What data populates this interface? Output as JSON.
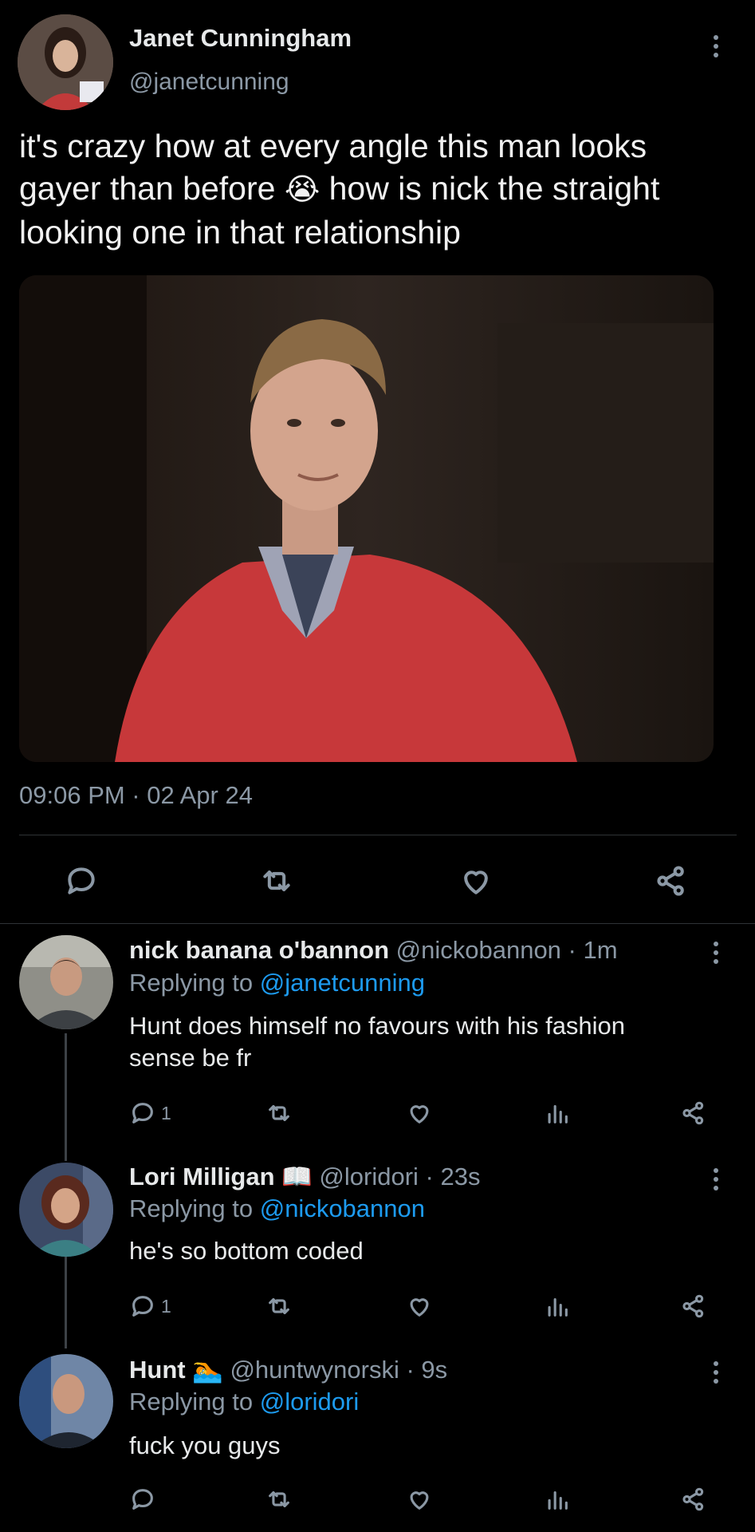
{
  "main_tweet": {
    "name": "Janet Cunningham",
    "handle": "@janetcunning",
    "text_line1": "it's crazy how at every angle this man looks",
    "text_line2a": "gayer than before",
    "text_emoji": "😭",
    "text_line2b": "how is nick the straight",
    "text_line3": "looking one in that relationship",
    "timestamp": "09:06 PM · 02 Apr 24"
  },
  "replies": [
    {
      "name": "nick banana o'bannon",
      "handle_time": "@nickobannon · 1m",
      "replying_prefix": "Replying to",
      "replying_to": "@janetcunning",
      "text_line1": "Hunt does himself no favours with his fashion",
      "text_line2": "sense be fr",
      "reply_count": "1"
    },
    {
      "name": "Lori Milligan",
      "name_emoji": "📖",
      "handle_time": "@loridori · 23s",
      "replying_prefix": "Replying to",
      "replying_to": "@nickobannon",
      "text_line1": "he's so bottom coded",
      "reply_count": "1"
    },
    {
      "name": "Hunt",
      "name_emoji": "🏊",
      "handle_time": "@huntwynorski · 9s",
      "replying_prefix": "Replying to",
      "replying_to": "@loridori",
      "text_line1": "fuck you guys",
      "reply_count": ""
    }
  ],
  "icons": [
    "more-icon",
    "reply-icon",
    "retweet-icon",
    "like-icon",
    "share-icon",
    "analytics-icon"
  ],
  "colors": {
    "background": "#000000",
    "text": "#e7e9ea",
    "muted": "#8b98a5",
    "link": "#1d9bf0"
  }
}
